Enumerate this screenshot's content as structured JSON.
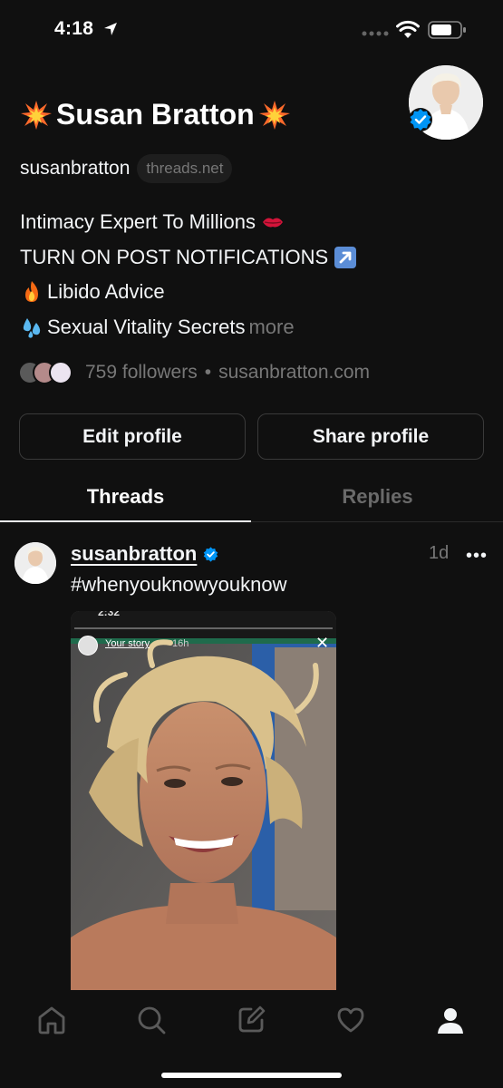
{
  "status_bar": {
    "time": "4:18"
  },
  "profile": {
    "name": "Susan Bratton",
    "handle": "susanbratton",
    "domain": "threads.net",
    "bio": {
      "line1": "Intimacy Expert To Millions",
      "line2": "TURN ON POST NOTIFICATIONS",
      "line3": "Libido Advice",
      "line4": "Sexual Vitality Secrets",
      "more": "more"
    },
    "followers": "759 followers",
    "website": "susanbratton.com"
  },
  "buttons": {
    "edit": "Edit profile",
    "share": "Share profile"
  },
  "tabs": {
    "threads": "Threads",
    "replies": "Replies"
  },
  "post": {
    "username": "susanbratton",
    "time": "1d",
    "more": "•••",
    "text": "#whenyouknowyouknow",
    "image": {
      "status_time": "2:32",
      "story_label": "Your story",
      "story_ago": "16h",
      "close": "✕"
    }
  },
  "nav": {
    "items": [
      "home-icon",
      "search-icon",
      "compose-icon",
      "activity-icon",
      "profile-icon"
    ]
  },
  "colors": {
    "background": "#101010",
    "text": "#f3f5f7",
    "muted": "#777777",
    "verified": "#0095f6"
  }
}
